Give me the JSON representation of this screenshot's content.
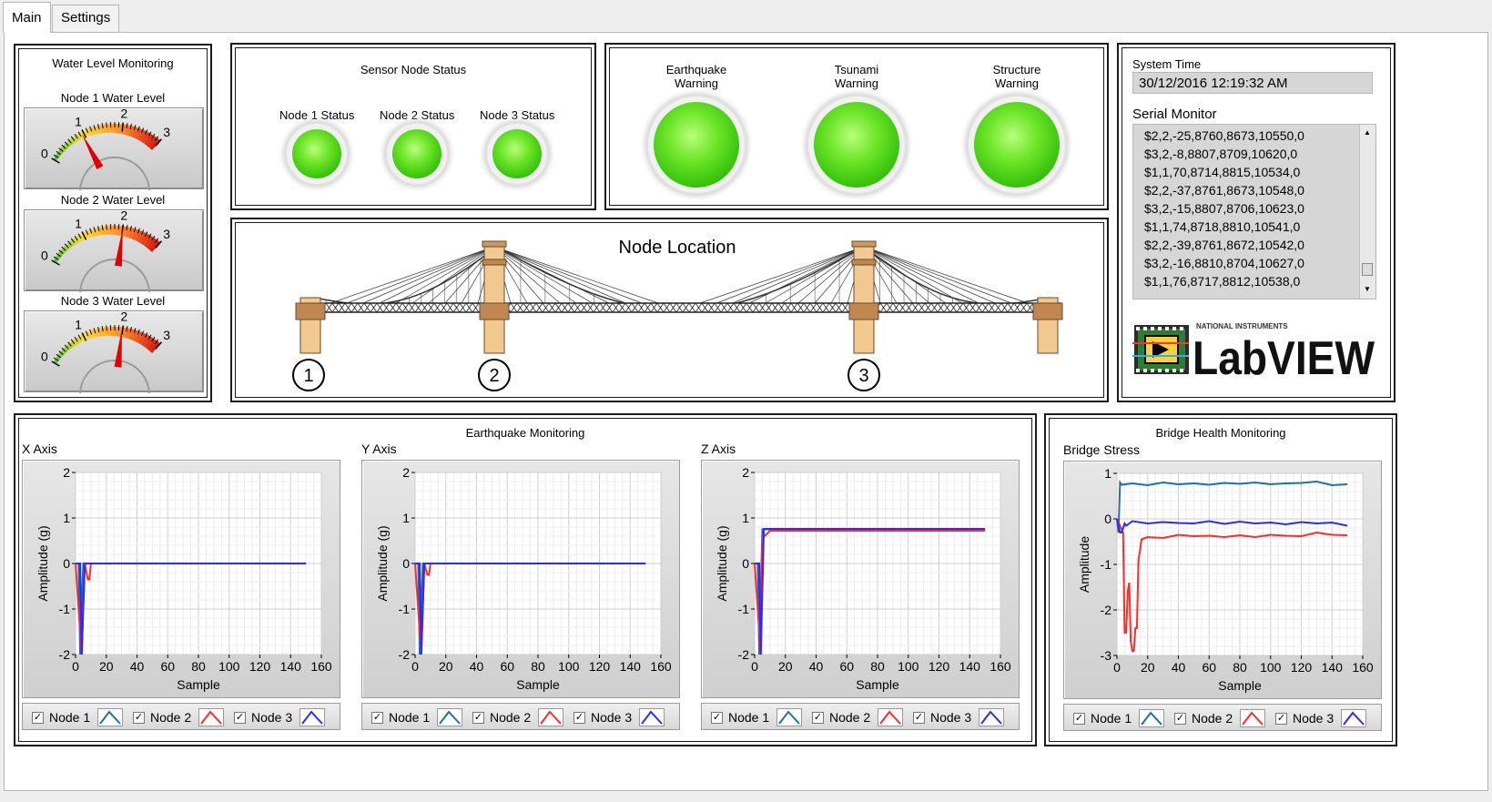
{
  "tabs": [
    {
      "label": "Main"
    },
    {
      "label": "Settings"
    }
  ],
  "water": {
    "title": "Water Level Monitoring",
    "gauges": [
      {
        "label": "Node 1 Water Level",
        "value": 0.95
      },
      {
        "label": "Node 2 Water Level",
        "value": 2.0
      },
      {
        "label": "Node 3 Water Level",
        "value": 1.98
      }
    ],
    "ticks": [
      "0",
      "1",
      "2",
      "3"
    ]
  },
  "sensor": {
    "title": "Sensor Node Status",
    "nodes": [
      {
        "label": "Node 1 Status"
      },
      {
        "label": "Node 2 Status"
      },
      {
        "label": "Node 3 Status"
      }
    ]
  },
  "warnings": [
    {
      "line1": "Earthquake",
      "line2": "Warning"
    },
    {
      "line1": "Tsunami",
      "line2": "Warning"
    },
    {
      "line1": "Structure",
      "line2": "Warning"
    }
  ],
  "location": {
    "title": "Node Location",
    "markers": [
      "1",
      "2",
      "3"
    ]
  },
  "system": {
    "time_label": "System Time",
    "time_value": "30/12/2016 12:19:32 AM",
    "serial_label": "Serial Monitor",
    "serial_lines": [
      "$2,2,-25,8760,8673,10550,0",
      "$3,2,-8,8807,8709,10620,0",
      "$1,1,70,8714,8815,10534,0",
      "$2,2,-37,8761,8673,10548,0",
      "$3,2,-15,8807,8706,10623,0",
      "$1,1,74,8718,8810,10541,0",
      "$2,2,-39,8761,8672,10542,0",
      "$3,2,-16,8810,8704,10627,0",
      "$1,1,76,8717,8812,10538,0"
    ],
    "logo_top": "NATIONAL INSTRUMENTS",
    "logo_main": "LabVIEW"
  },
  "colors": {
    "node1": "#1f6fa8",
    "node2": "#ff2a2a",
    "node3": "#2a2aff",
    "led": "#5cd41f"
  },
  "earthquake": {
    "title": "Earthquake Monitoring"
  },
  "bridge": {
    "title": "Bridge Health Monitoring"
  },
  "legend": {
    "items": [
      {
        "label": "Node 1",
        "checked": "✓"
      },
      {
        "label": "Node 2",
        "checked": "✓"
      },
      {
        "label": "Node 3",
        "checked": "✓"
      }
    ]
  },
  "chart_data": [
    {
      "type": "line",
      "title": "X Axis",
      "xlabel": "Sample",
      "ylabel": "Amplitude (g)",
      "xlim": [
        0,
        160
      ],
      "ylim": [
        -2,
        2
      ],
      "xticks": [
        "0",
        "20",
        "40",
        "60",
        "80",
        "100",
        "120",
        "140",
        "160"
      ],
      "yticks": [
        "2",
        "1",
        "0",
        "-1",
        "-2"
      ],
      "series": [
        {
          "name": "Node 1",
          "x": [
            0,
            2,
            3,
            5,
            150
          ],
          "y": [
            0,
            0,
            -2,
            0,
            0
          ]
        },
        {
          "name": "Node 2",
          "x": [
            0,
            4,
            6,
            8,
            9,
            10,
            150
          ],
          "y": [
            0,
            -2,
            0,
            -0.35,
            -0.35,
            0,
            0
          ]
        },
        {
          "name": "Node 3",
          "x": [
            0,
            3,
            4,
            6,
            150
          ],
          "y": [
            0,
            0,
            -2,
            0,
            0
          ]
        }
      ]
    },
    {
      "type": "line",
      "title": "Y Axis",
      "xlabel": "Sample",
      "ylabel": "Amplitude (g)",
      "xlim": [
        0,
        160
      ],
      "ylim": [
        -2,
        2
      ],
      "xticks": [
        "0",
        "20",
        "40",
        "60",
        "80",
        "100",
        "120",
        "140",
        "160"
      ],
      "yticks": [
        "2",
        "1",
        "0",
        "-1",
        "-2"
      ],
      "series": [
        {
          "name": "Node 1",
          "x": [
            0,
            2,
            3,
            5,
            150
          ],
          "y": [
            0,
            0,
            -2,
            0,
            0
          ]
        },
        {
          "name": "Node 2",
          "x": [
            0,
            4,
            6,
            8,
            9,
            10,
            150
          ],
          "y": [
            0,
            -2,
            0,
            -0.25,
            -0.25,
            0,
            0
          ]
        },
        {
          "name": "Node 3",
          "x": [
            0,
            3,
            4,
            6,
            150
          ],
          "y": [
            0,
            0,
            -2,
            0,
            0
          ]
        }
      ]
    },
    {
      "type": "line",
      "title": "Z Axis",
      "xlabel": "Sample",
      "ylabel": "Amplitude (g)",
      "xlim": [
        0,
        160
      ],
      "ylim": [
        -2,
        2
      ],
      "xticks": [
        "0",
        "20",
        "40",
        "60",
        "80",
        "100",
        "120",
        "140",
        "160"
      ],
      "yticks": [
        "2",
        "1",
        "0",
        "-1",
        "-2"
      ],
      "series": [
        {
          "name": "Node 1",
          "x": [
            0,
            2,
            3,
            5,
            150
          ],
          "y": [
            0,
            0,
            -2,
            0.75,
            0.75
          ]
        },
        {
          "name": "Node 2",
          "x": [
            0,
            4,
            5,
            7,
            10,
            150
          ],
          "y": [
            0,
            -2,
            0.55,
            0.62,
            0.72,
            0.72
          ]
        },
        {
          "name": "Node 3",
          "x": [
            0,
            3,
            4,
            6,
            150
          ],
          "y": [
            0,
            0,
            -2,
            0.76,
            0.76
          ]
        }
      ]
    },
    {
      "type": "line",
      "title": "Bridge Stress",
      "xlabel": "Sample",
      "ylabel": "Amplitude",
      "xlim": [
        0,
        160
      ],
      "ylim": [
        -3,
        1
      ],
      "xticks": [
        "0",
        "20",
        "40",
        "60",
        "80",
        "100",
        "120",
        "140",
        "160"
      ],
      "yticks": [
        "1",
        "0",
        "-1",
        "-2",
        "-3"
      ],
      "series": [
        {
          "name": "Node 1",
          "x": [
            0,
            1,
            2,
            3,
            10,
            20,
            30,
            40,
            50,
            60,
            70,
            80,
            90,
            100,
            110,
            120,
            130,
            140,
            150
          ],
          "y": [
            0,
            -0.3,
            0.8,
            0.75,
            0.78,
            0.74,
            0.8,
            0.76,
            0.78,
            0.75,
            0.79,
            0.77,
            0.8,
            0.76,
            0.78,
            0.79,
            0.82,
            0.74,
            0.76
          ]
        },
        {
          "name": "Node 2",
          "x": [
            0,
            4,
            5,
            6,
            7,
            8,
            9,
            10,
            11,
            12,
            13,
            14,
            15,
            16,
            20,
            30,
            40,
            50,
            60,
            70,
            80,
            90,
            100,
            110,
            120,
            130,
            140,
            150
          ],
          "y": [
            0,
            -0.3,
            -2.5,
            -2.5,
            -1.6,
            -1.4,
            -2.7,
            -2.9,
            -2.9,
            -2.4,
            -2.4,
            -0.9,
            -0.7,
            -0.45,
            -0.4,
            -0.42,
            -0.35,
            -0.38,
            -0.37,
            -0.4,
            -0.36,
            -0.4,
            -0.35,
            -0.37,
            -0.38,
            -0.3,
            -0.35,
            -0.36
          ]
        },
        {
          "name": "Node 3",
          "x": [
            0,
            2,
            3,
            5,
            6,
            10,
            20,
            30,
            40,
            50,
            60,
            70,
            80,
            90,
            100,
            110,
            120,
            130,
            140,
            150
          ],
          "y": [
            0,
            -0.3,
            -0.3,
            -0.1,
            -0.15,
            -0.05,
            -0.1,
            -0.07,
            -0.09,
            -0.1,
            -0.05,
            -0.11,
            -0.06,
            -0.1,
            -0.08,
            -0.12,
            -0.07,
            -0.1,
            -0.08,
            -0.15
          ]
        }
      ]
    }
  ]
}
